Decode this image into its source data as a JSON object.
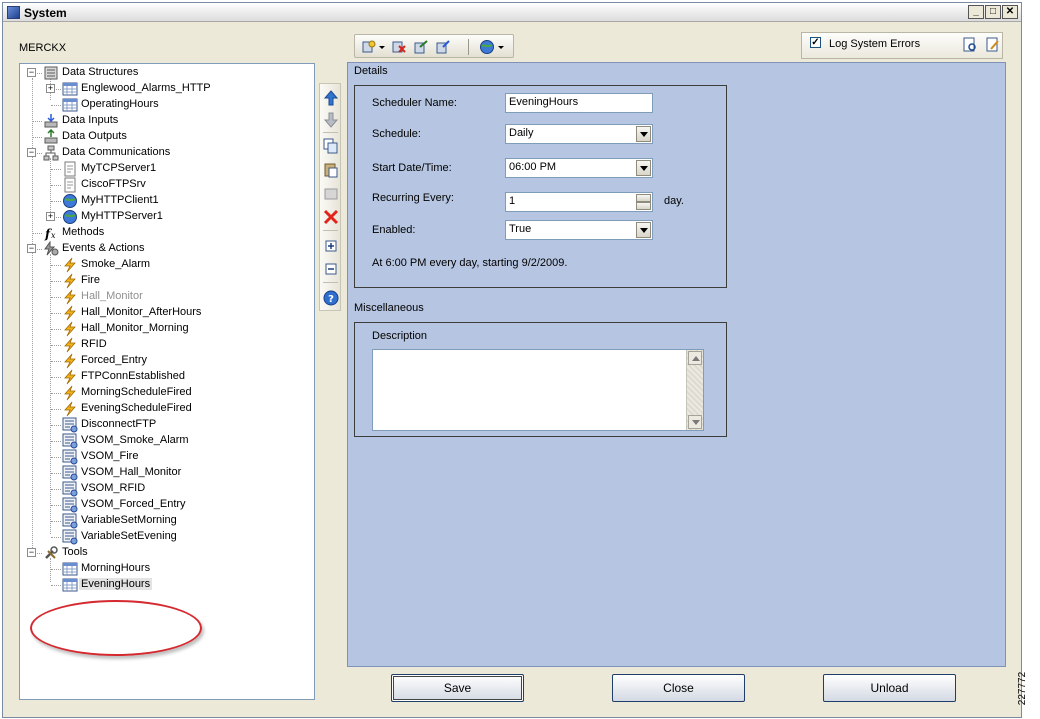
{
  "window": {
    "title": "System"
  },
  "machine_name": "MERCKX",
  "log_system_errors": {
    "label": "Log System Errors",
    "checked": true
  },
  "tree": {
    "items": [
      {
        "label": "Data Structures",
        "icon": "data-structures-icon"
      },
      {
        "label": "Englewood_Alarms_HTTP",
        "icon": "table-icon"
      },
      {
        "label": "OperatingHours",
        "icon": "table-icon"
      },
      {
        "label": "Data Inputs",
        "icon": "data-input-icon"
      },
      {
        "label": "Data Outputs",
        "icon": "data-output-icon"
      },
      {
        "label": "Data Communications",
        "icon": "network-icon"
      },
      {
        "label": "MyTCPServer1",
        "icon": "document-icon"
      },
      {
        "label": "CiscoFTPSrv",
        "icon": "document-icon"
      },
      {
        "label": "MyHTTPClient1",
        "icon": "globe-icon"
      },
      {
        "label": "MyHTTPServer1",
        "icon": "globe-icon"
      },
      {
        "label": "Methods",
        "icon": "function-icon"
      },
      {
        "label": "Events & Actions",
        "icon": "events-icon"
      },
      {
        "label": "Smoke_Alarm",
        "icon": "lightning-icon"
      },
      {
        "label": "Fire",
        "icon": "lightning-icon"
      },
      {
        "label": "Hall_Monitor",
        "icon": "lightning-icon"
      },
      {
        "label": "Hall_Monitor_AfterHours",
        "icon": "lightning-icon"
      },
      {
        "label": "Hall_Monitor_Morning",
        "icon": "lightning-icon"
      },
      {
        "label": "RFID",
        "icon": "lightning-icon"
      },
      {
        "label": "Forced_Entry",
        "icon": "lightning-icon"
      },
      {
        "label": "FTPConnEstablished",
        "icon": "lightning-icon"
      },
      {
        "label": "MorningScheduleFired",
        "icon": "lightning-icon"
      },
      {
        "label": "EveningScheduleFired",
        "icon": "lightning-icon"
      },
      {
        "label": "DisconnectFTP",
        "icon": "action-icon"
      },
      {
        "label": "VSOM_Smoke_Alarm",
        "icon": "action-icon"
      },
      {
        "label": "VSOM_Fire",
        "icon": "action-icon"
      },
      {
        "label": "VSOM_Hall_Monitor",
        "icon": "action-icon"
      },
      {
        "label": "VSOM_RFID",
        "icon": "action-icon"
      },
      {
        "label": "VSOM_Forced_Entry",
        "icon": "action-icon"
      },
      {
        "label": "VariableSetMorning",
        "icon": "action-icon"
      },
      {
        "label": "VariableSetEvening",
        "icon": "action-icon"
      },
      {
        "label": "Tools",
        "icon": "tools-icon"
      },
      {
        "label": "MorningHours",
        "icon": "calendar-icon"
      },
      {
        "label": "EveningHours",
        "icon": "calendar-icon"
      }
    ]
  },
  "details": {
    "section_label": "Details",
    "fields": {
      "scheduler_name": {
        "label": "Scheduler Name:",
        "value": "EveningHours"
      },
      "schedule": {
        "label": "Schedule:",
        "value": "Daily"
      },
      "start": {
        "label": "Start Date/Time:",
        "value": "06:00 PM"
      },
      "recurring": {
        "label": "Recurring Every:",
        "value": "1",
        "unit": "day."
      },
      "enabled": {
        "label": "Enabled:",
        "value": "True"
      }
    },
    "summary": "At 6:00 PM every day, starting 9/2/2009."
  },
  "misc": {
    "section_label": "Miscellaneous",
    "description_label": "Description",
    "description_value": ""
  },
  "buttons": {
    "save": "Save",
    "close": "Close",
    "unload": "Unload"
  },
  "figure_id": "227772",
  "colors": {
    "details_bg": "#b6c6e2",
    "tree_highlight": "#d4292f",
    "window_bg": "#ece9d8"
  }
}
